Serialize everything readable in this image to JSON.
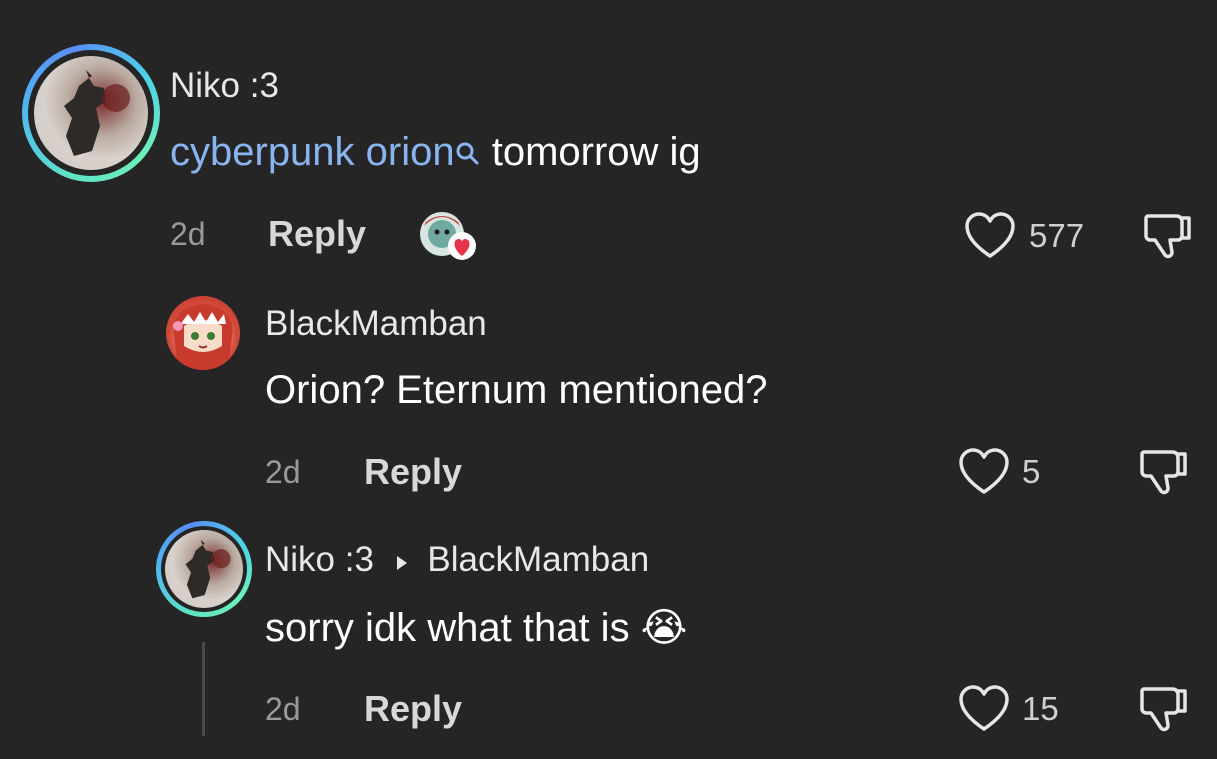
{
  "comments": [
    {
      "username": "Niko :3",
      "text_link": "cyberpunk orion",
      "text_rest": " tomorrow ig",
      "age": "2d",
      "reply_label": "Reply",
      "likes": "577",
      "avatar_icon": "wolf-avatar",
      "reaction_icon": "creator-heart-reaction-icon"
    },
    {
      "username": "BlackMamban",
      "text": "Orion? Eternum mentioned?",
      "age": "2d",
      "reply_label": "Reply",
      "likes": "5",
      "avatar_icon": "anime-girl-avatar"
    },
    {
      "username": "Niko :3",
      "reply_to": "BlackMamban",
      "text": "sorry idk what that is 😭",
      "age": "2d",
      "reply_label": "Reply",
      "likes": "15",
      "avatar_icon": "wolf-avatar"
    }
  ],
  "colors": {
    "background": "#252525",
    "link": "#8ab4f0",
    "ring": "#4fd1e8"
  }
}
